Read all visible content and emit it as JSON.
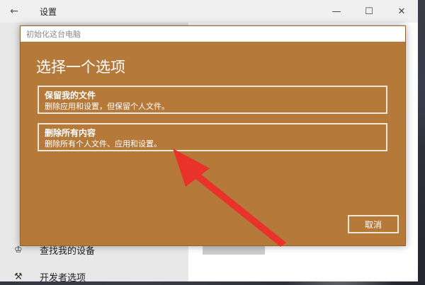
{
  "settings": {
    "title": "设置",
    "back_icon": "arrow-left-icon",
    "controls": {
      "minimize": "—",
      "maximize": "☐",
      "close": "✕"
    },
    "sidebar": {
      "items": [
        {
          "icon": "person-icon",
          "label": "查找我的设备"
        },
        {
          "icon": "wrench-icon",
          "label": "开发者选项"
        }
      ]
    }
  },
  "dialog": {
    "window_title": "初始化这台电脑",
    "heading": "选择一个选项",
    "options": [
      {
        "title": "保留我的文件",
        "description": "删除应用和设置，但保留个人文件。"
      },
      {
        "title": "删除所有内容",
        "description": "删除所有个人文件、应用和设置。"
      }
    ],
    "cancel_label": "取消"
  },
  "annotation": {
    "arrow_color": "#e8322a"
  },
  "colors": {
    "dialog_bg": "#b5793a",
    "dialog_border": "#f3e6d6"
  }
}
